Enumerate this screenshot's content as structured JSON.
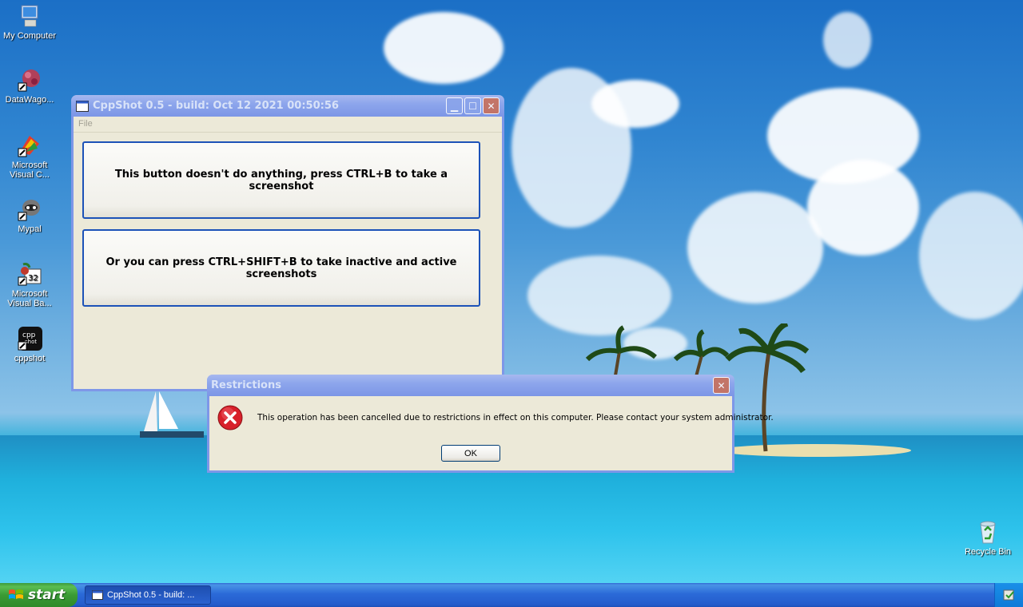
{
  "desktop": {
    "icons": [
      {
        "label": "My Computer"
      },
      {
        "label": "DataWago..."
      },
      {
        "label": "Microsoft Visual C..."
      },
      {
        "label": "Mypal"
      },
      {
        "label": "Microsoft Visual Ba..."
      },
      {
        "label": "cppshot"
      },
      {
        "label": "Recycle Bin"
      }
    ]
  },
  "main_window": {
    "title": "CppShot 0.5 - build: Oct 12 2021 00:50:56",
    "menu": {
      "file": "File"
    },
    "button1_label": "This button doesn't do anything, press CTRL+B to take a screenshot",
    "button2_label": "Or you can press CTRL+SHIFT+B to take inactive and active screenshots"
  },
  "dialog": {
    "title": "Restrictions",
    "message": "This operation has been cancelled due to restrictions in effect on this computer. Please contact your system administrator.",
    "ok_label": "OK",
    "icon": "error-icon"
  },
  "taskbar": {
    "start_label": "start",
    "items": [
      {
        "label": "CppShot 0.5 - build: ..."
      }
    ]
  },
  "colors": {
    "title_active": "#0553d8",
    "title_inactive": "#8da6ec",
    "start_green": "#3a9b34",
    "window_face": "#ece9d8"
  }
}
